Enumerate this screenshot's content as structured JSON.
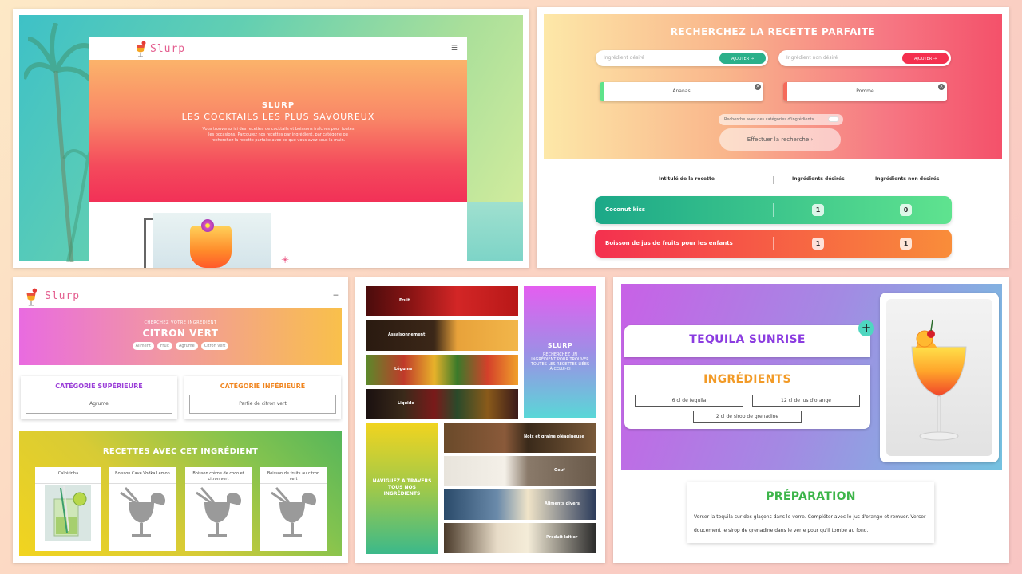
{
  "home": {
    "logo_text": "Slurp",
    "hero_title": "SLURP",
    "hero_subtitle": "LES COCKTAILS LES PLUS SAVOUREUX",
    "hero_text": "Vous trouverez ici des recettes de cocktails et boissons fraîches pour toutes les occasions. Parcourez nos recettes par ingrédient, par catégorie ou recherchez la recette parfaite avec ce que vous avez sous la main.",
    "menu_icon": "hamburger-icon"
  },
  "search": {
    "title": "RECHERCHEZ LA RECETTE PARFAITE",
    "wanted_placeholder": "Ingrédient désiré",
    "unwanted_placeholder": "Ingrédient non désiré",
    "add_label": "AJOUTER →",
    "wanted_tag": "Ananas",
    "unwanted_tag": "Pomme",
    "toggle_label": "Recherche avec des catégories d'ingrédients",
    "submit_label": "Effectuer la recherche  ›",
    "col_recipe": "Intitulé de la recette",
    "col_wanted": "Ingrédients désirés",
    "col_unwanted": "Ingrédients non désirés",
    "results": [
      {
        "name": "Coconut kiss",
        "wanted": "1",
        "unwanted": "0"
      },
      {
        "name": "Boisson de jus de fruits pour les enfants",
        "wanted": "1",
        "unwanted": "1"
      }
    ],
    "colors": {
      "green": "#2bb08a",
      "red": "#f4304f"
    }
  },
  "ingredient": {
    "logo_text": "Slurp",
    "banner_sub": "CHERCHEZ VOTRE INGRÉDIENT",
    "banner_title": "CITRON VERT",
    "chips": [
      "Aliment",
      "Fruit",
      "Agrume",
      "Citron vert"
    ],
    "cat_sup_title": "CATÉGORIE SUPÉRIEURE",
    "cat_sup_value": "Agrume",
    "cat_inf_title": "CATÉGORIE INFÉRIEURE",
    "cat_inf_value": "Partie de citron vert",
    "recipes_title": "RECETTES AVEC CET INGRÉDIENT",
    "recipes": [
      "Caïpirinha",
      "Boisson Cave Vodka Lemon",
      "Boisson crème de coco et citron vert",
      "Boisson de fruits au citron vert"
    ]
  },
  "categories": {
    "tiles_left": [
      "Fruit",
      "Assaisonnement",
      "Légume",
      "Liquide"
    ],
    "tiles_right": [
      "Noix et graine oléagineuse",
      "Oeuf",
      "Aliments divers",
      "Produit laitier"
    ],
    "side_title": "SLURP",
    "side_text": "RECHERCHEZ UN INGRÉDIENT POUR TROUVER TOUTES LES RECETTES LIÉES À CELUI-CI",
    "nav_text": "NAVIGUEZ À TRAVERS TOUS NOS INGRÉDIENTS"
  },
  "recipe": {
    "title": "TEQUILA SUNRISE",
    "ingredients_title": "INGRÉDIENTS",
    "ingredients": [
      "6 cl de tequila",
      "12 cl de jus d'orange",
      "2 cl de sirop de grenadine"
    ],
    "preparation_title": "PRÉPARATION",
    "preparation_text": "Verser la tequila sur des glaçons dans le verre. Compléter avec le jus d'orange et remuer. Verser doucement le sirop de grenadine dans le verre pour qu'il tombe au fond.",
    "add_icon": "plus-icon"
  }
}
